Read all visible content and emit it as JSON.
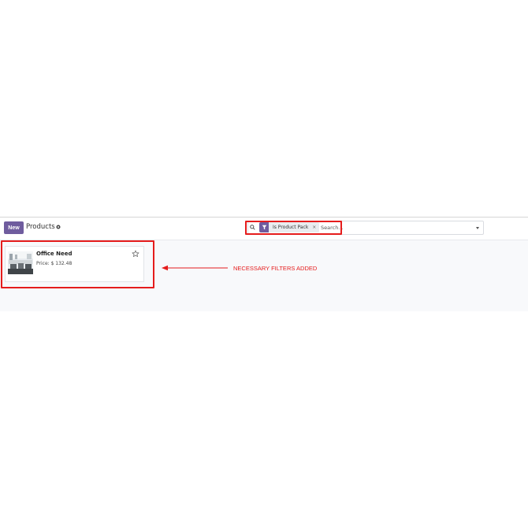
{
  "controlbar": {
    "new_label": "New",
    "title": "Products",
    "gear_icon": "gear-icon"
  },
  "search": {
    "icon": "search-icon",
    "facet_icon": "filter-icon",
    "facet_label": "Is Product Pack",
    "facet_remove": "×",
    "placeholder": "Search...",
    "toggle_icon": "caret-down-icon"
  },
  "kanban": {
    "cards": [
      {
        "name": "Office Need",
        "price": "Price: $ 132.48",
        "favorite_icon": "star-icon"
      }
    ]
  },
  "annotation": {
    "text": "NECESSARY FILTERS ADDED",
    "color": "#e51c1c"
  },
  "colors": {
    "accent": "#6f5c9e",
    "highlight": "#e51c1c"
  }
}
